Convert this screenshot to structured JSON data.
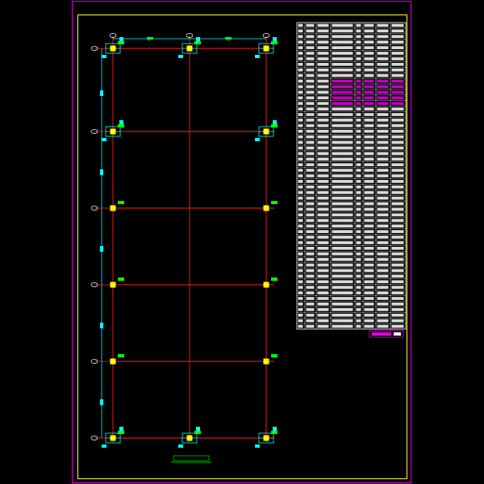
{
  "drawing": {
    "title": "",
    "table_title": "",
    "table_note": "",
    "colors": {
      "background": "#000000",
      "sheet_border": "#e000e0",
      "inner_frame": "#ffff40",
      "grid_axis": "#ff2020",
      "column": "#ffff00",
      "detail": "#00ffff",
      "label": "#00ff00",
      "table_line": "#ffffff",
      "table_text": "#ffffff",
      "table_highlight": "#e000e0"
    },
    "grid": {
      "columns": 3,
      "rows": 6
    },
    "table": {
      "column_count": 8,
      "row_count": 55,
      "highlight_rows_from": 10,
      "highlight_rows_to": 14
    }
  }
}
